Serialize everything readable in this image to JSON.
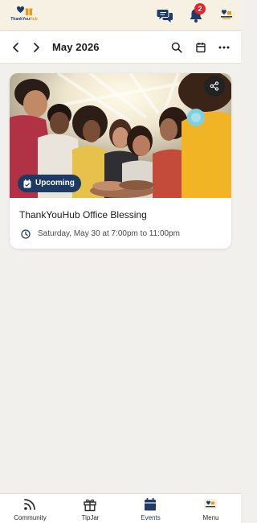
{
  "app": {
    "logo_text_main": "ThankYou",
    "logo_text_accent": "Hub",
    "notification_count": "2"
  },
  "toolbar": {
    "month": "May 2026"
  },
  "event": {
    "status": "Upcoming",
    "title": "ThankYouHub Office Blessing",
    "time": "Saturday, May 30 at 7:00pm to 11:00pm"
  },
  "nav": {
    "items": [
      {
        "label": "Community",
        "icon": "rss-icon"
      },
      {
        "label": "TipJar",
        "icon": "gift-icon"
      },
      {
        "label": "Events",
        "icon": "calendar-icon"
      },
      {
        "label": "Menu",
        "icon": "menu-logo-icon"
      }
    ],
    "active": "Events"
  },
  "colors": {
    "brand_navy": "#1f3b66",
    "brand_gold": "#e39b1b",
    "badge_red": "#e4262d",
    "header_bg": "#f7f1e3",
    "page_bg": "#f2f0ec"
  }
}
